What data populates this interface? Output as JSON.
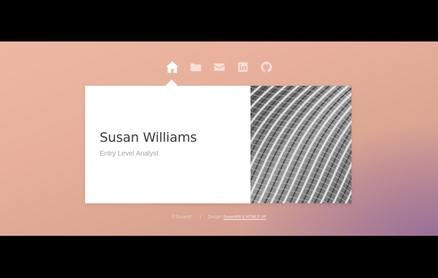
{
  "nav": {
    "items": [
      {
        "icon": "home-icon",
        "active": true
      },
      {
        "icon": "folder-icon",
        "active": false
      },
      {
        "icon": "envelope-icon",
        "active": false
      },
      {
        "icon": "linkedin-icon",
        "active": false
      },
      {
        "icon": "github-icon",
        "active": false
      }
    ]
  },
  "profile": {
    "name": "Susan Williams",
    "title": "Entry Level Analyst"
  },
  "footer": {
    "copyright": "© SusanW.",
    "design_prefix": "Design:",
    "design_link": "SusanWil & HTML5 UP"
  },
  "colors": {
    "background_top": "#edb8a3",
    "background_bottom_right": "#8c6496",
    "panel": "#ffffff",
    "name_text": "#3a3a3a",
    "subtitle_text": "#a4a4a4"
  }
}
